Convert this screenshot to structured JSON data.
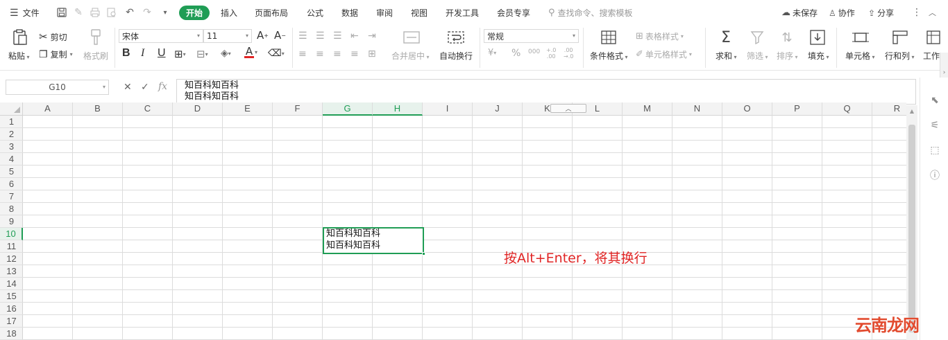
{
  "menubar": {
    "file_label": "文件",
    "tabs": [
      "开始",
      "插入",
      "页面布局",
      "公式",
      "数据",
      "审阅",
      "视图",
      "开发工具",
      "会员专享"
    ],
    "search_placeholder": "查找命令、搜索模板",
    "unsaved_label": "未保存",
    "collab_label": "协作",
    "share_label": "分享"
  },
  "ribbon": {
    "paste": "粘贴",
    "cut": "剪切",
    "copy": "复制",
    "format_painter": "格式刷",
    "font_name": "宋体",
    "font_size": "11",
    "merge_center": "合并居中",
    "wrap_text": "自动换行",
    "number_format": "常规",
    "conditional_format": "条件格式",
    "table_style": "表格样式",
    "cell_style": "单元格样式",
    "sum": "求和",
    "filter": "筛选",
    "sort": "排序",
    "fill": "填充",
    "cell": "单元格",
    "row_col": "行和列",
    "worksheet": "工作"
  },
  "formula_bar": {
    "name_box": "G10",
    "fx": "fx",
    "content": "知百科知百科\n知百科知百科"
  },
  "sheet": {
    "columns": [
      "A",
      "B",
      "C",
      "D",
      "E",
      "F",
      "G",
      "H",
      "I",
      "J",
      "K",
      "L",
      "M",
      "N",
      "O",
      "P",
      "Q",
      "R"
    ],
    "rows": [
      "1",
      "2",
      "3",
      "4",
      "5",
      "6",
      "7",
      "8",
      "9",
      "10",
      "11",
      "12",
      "13",
      "14",
      "15",
      "16",
      "17",
      "18"
    ],
    "selected_cell": "G10",
    "cell_g10": "知百科知百科\n知百科知百科"
  },
  "annotation": "按Alt+Enter，将其换行",
  "watermark": "云南龙网",
  "colors": {
    "accent": "#1f9d55",
    "annotation": "#e02424",
    "watermark": "#e24b2f"
  }
}
